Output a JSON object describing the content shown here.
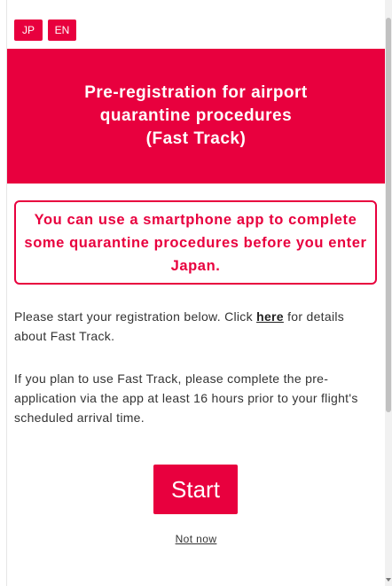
{
  "language": {
    "jp_label": "JP",
    "en_label": "EN"
  },
  "banner": {
    "title_line1": "Pre-registration for airport",
    "title_line2": "quarantine procedures",
    "title_line3": "(Fast Track)"
  },
  "notice": {
    "text": "You can use a smartphone app to complete some quarantine procedures before you enter Japan."
  },
  "intro": {
    "before_link": "Please start your registration below. Click ",
    "link_label": "here",
    "after_link": " for details about Fast Track."
  },
  "info": {
    "text": "If you plan to use Fast Track, please complete the pre-application via the app at least 16 hours prior to your flight's scheduled arrival time."
  },
  "actions": {
    "start_label": "Start",
    "not_now_label": "Not now"
  },
  "colors": {
    "accent": "#e8003e"
  }
}
